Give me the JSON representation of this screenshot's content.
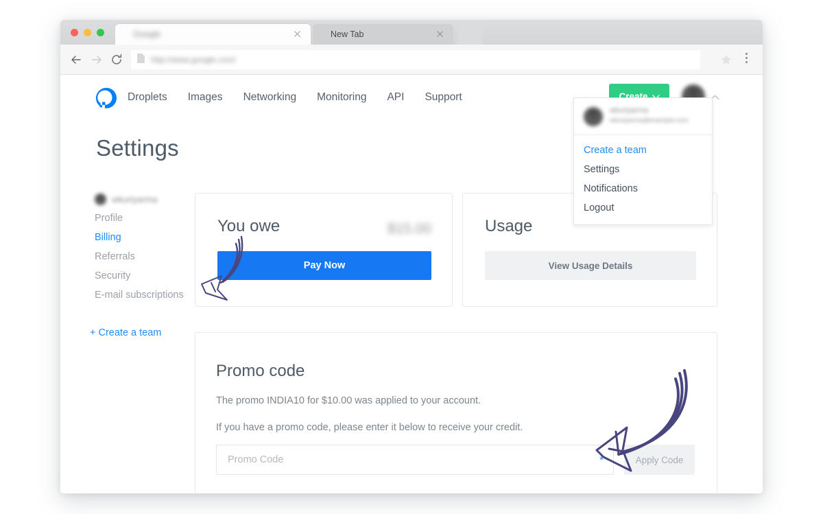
{
  "browser": {
    "tabs": [
      {
        "title": "Google",
        "blurred": true,
        "close_icon": "close-icon"
      },
      {
        "title": "New Tab",
        "blurred": false,
        "close_icon": "close-icon"
      }
    ],
    "new_tab_button": "new-tab-icon",
    "toolbar": {
      "back_icon": "back-arrow-icon",
      "forward_icon": "forward-arrow-icon",
      "reload_icon": "reload-icon",
      "page_icon": "document-icon",
      "url": "http://www.google.com/",
      "star_icon": "star-icon",
      "menu_icon": "three-dot-menu-icon"
    }
  },
  "site_nav": {
    "logo": "digitalocean-logo",
    "links": [
      "Droplets",
      "Images",
      "Networking",
      "Monitoring",
      "API",
      "Support"
    ],
    "create_label": "Create",
    "create_caret": "chevron-down-icon",
    "avatar": "user-avatar",
    "caret": "chevron-up-icon"
  },
  "account_dropdown": {
    "user_name": "wkuriyarma",
    "user_email": "wkuriyarma@example.com",
    "items": [
      {
        "label": "Create a team",
        "style": "link"
      },
      {
        "label": "Settings",
        "style": "normal"
      },
      {
        "label": "Notifications",
        "style": "normal"
      },
      {
        "label": "Logout",
        "style": "normal"
      }
    ]
  },
  "page": {
    "title": "Settings"
  },
  "sidebar": {
    "username": "wkuriyarma",
    "avatar": "user-avatar",
    "items": [
      {
        "label": "Profile",
        "active": false
      },
      {
        "label": "Billing",
        "active": true
      },
      {
        "label": "Referrals",
        "active": false
      },
      {
        "label": "Security",
        "active": false
      },
      {
        "label": "E-mail subscriptions",
        "active": false
      }
    ],
    "create_team_label": "+ Create a team"
  },
  "owe_card": {
    "title": "You owe",
    "amount": "$15.00",
    "pay_label": "Pay Now"
  },
  "usage_card": {
    "title": "Usage",
    "view_label": "View Usage Details"
  },
  "promo_card": {
    "title": "Promo code",
    "applied_text": "The promo INDIA10 for $10.00 was applied to your account.",
    "hint_text": "If you have a promo code, please enter it below to receive your credit.",
    "input_placeholder": "Promo Code",
    "input_value": "",
    "required_marker": "*",
    "apply_label": "Apply Code"
  },
  "annotations": {
    "arrow_color": "#49457f",
    "arrows": [
      {
        "name": "arrow-pointing-to-billing",
        "target": "Billing"
      },
      {
        "name": "arrow-pointing-to-promo-card",
        "target": "Promo code"
      }
    ]
  },
  "colors": {
    "accent_blue": "#1f8dfb",
    "pay_blue": "#1678f2",
    "create_green": "#2fce84",
    "text_dark": "#4e5a66",
    "text_muted": "#9aa1a8",
    "arrow_purple": "#49457f"
  }
}
